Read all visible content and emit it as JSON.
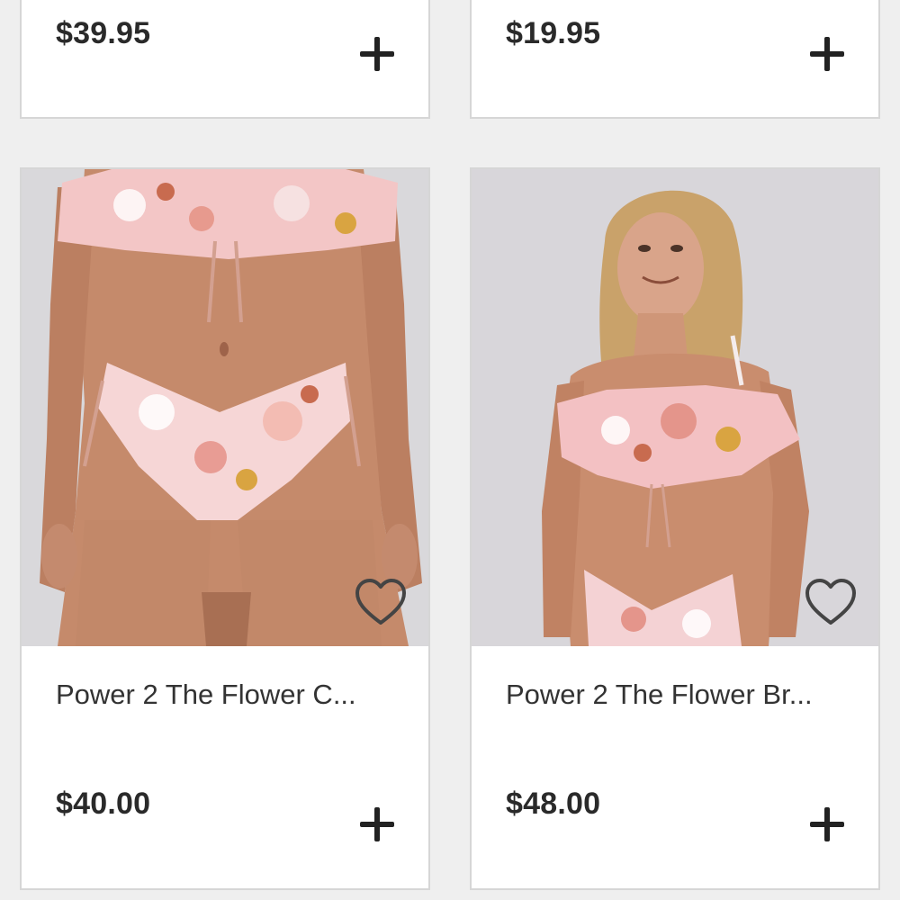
{
  "products": [
    {
      "price": "$39.95"
    },
    {
      "price": "$19.95"
    },
    {
      "name": "Power 2 The Flower C...",
      "price": "$40.00"
    },
    {
      "name": "Power 2 The Flower Br...",
      "price": "$48.00"
    }
  ],
  "icons": {
    "add": "plus-icon",
    "wishlist": "heart-outline-icon"
  },
  "colors": {
    "background": "#efefef",
    "card": "#ffffff",
    "text": "#2a2a2a"
  }
}
